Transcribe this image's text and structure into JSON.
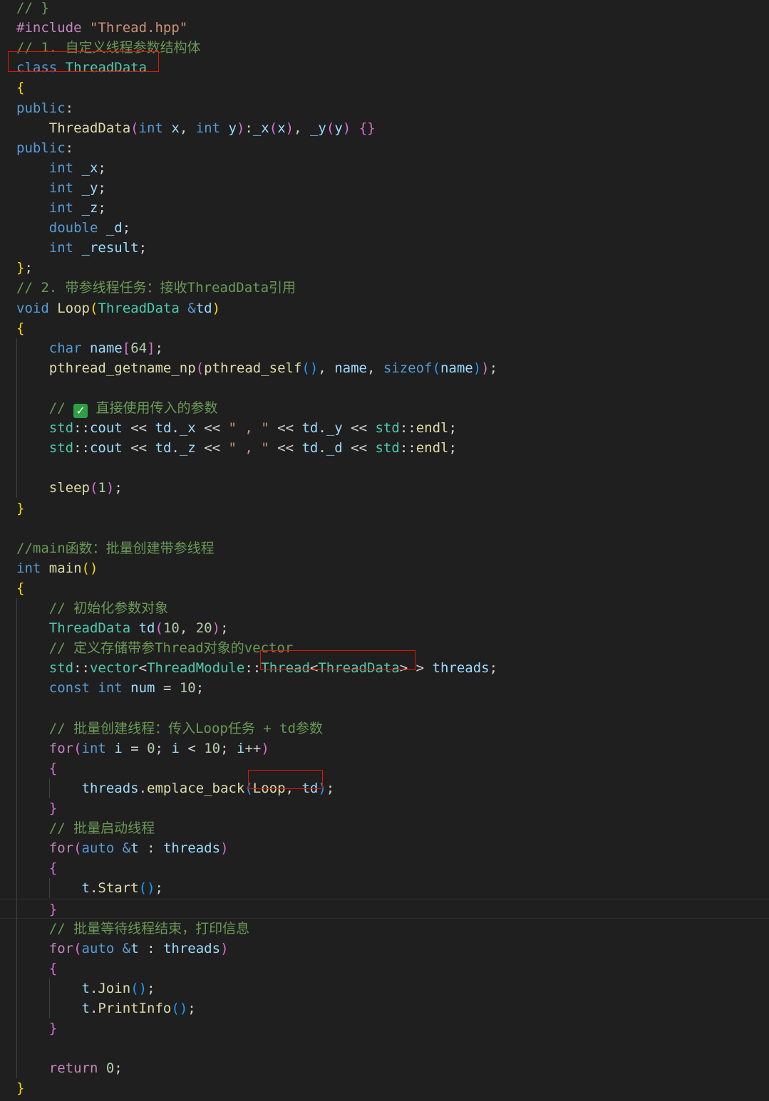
{
  "editor": {
    "language": "cpp",
    "colors": {
      "background": "#1f1f1f",
      "text": "#d4d4d4",
      "keyword": "#569cd6",
      "control": "#c586c0",
      "type": "#4ec9b0",
      "function": "#dcdcaa",
      "variable": "#9cdcfe",
      "string": "#ce9178",
      "number": "#b5cea8",
      "comment": "#6a9955",
      "macro": "#c586c0",
      "bracket_1": "#ffd700",
      "bracket_2": "#da70d6",
      "bracket_3": "#179fff",
      "highlight_box": "#e51400",
      "checkmark": "#2ea043"
    },
    "lines": [
      [
        {
          "t": "// }",
          "c": "#6a9955"
        }
      ],
      [
        {
          "t": "#include ",
          "c": "#c586c0"
        },
        {
          "t": "\"Thread.hpp\"",
          "c": "#ce9178"
        }
      ],
      [
        {
          "t": "// 1. 自定义线程参数结构体",
          "c": "#6a9955"
        }
      ],
      [
        {
          "t": "class ",
          "c": "#569cd6"
        },
        {
          "t": "ThreadData",
          "c": "#4ec9b0"
        }
      ],
      [
        {
          "t": "{",
          "c": "#ffd700"
        }
      ],
      [
        {
          "t": "public",
          "c": "#569cd6"
        },
        {
          "t": ":",
          "c": "#d4d4d4"
        }
      ],
      [
        {
          "t": "    "
        },
        {
          "t": "ThreadData",
          "c": "#dcdcaa"
        },
        {
          "t": "(",
          "c": "#da70d6"
        },
        {
          "t": "int ",
          "c": "#569cd6"
        },
        {
          "t": "x",
          "c": "#9cdcfe"
        },
        {
          "t": ", "
        },
        {
          "t": "int ",
          "c": "#569cd6"
        },
        {
          "t": "y",
          "c": "#9cdcfe"
        },
        {
          "t": ")",
          "c": "#da70d6"
        },
        {
          "t": ":"
        },
        {
          "t": "_x",
          "c": "#9cdcfe"
        },
        {
          "t": "(",
          "c": "#da70d6"
        },
        {
          "t": "x",
          "c": "#9cdcfe"
        },
        {
          "t": ")",
          "c": "#da70d6"
        },
        {
          "t": ", "
        },
        {
          "t": "_y",
          "c": "#9cdcfe"
        },
        {
          "t": "(",
          "c": "#da70d6"
        },
        {
          "t": "y",
          "c": "#9cdcfe"
        },
        {
          "t": ")",
          "c": "#da70d6"
        },
        {
          "t": " "
        },
        {
          "t": "{}",
          "c": "#da70d6"
        }
      ],
      [
        {
          "t": "public",
          "c": "#569cd6"
        },
        {
          "t": ":",
          "c": "#d4d4d4"
        }
      ],
      [
        {
          "t": "    "
        },
        {
          "t": "int ",
          "c": "#569cd6"
        },
        {
          "t": "_x",
          "c": "#9cdcfe"
        },
        {
          "t": ";"
        }
      ],
      [
        {
          "t": "    "
        },
        {
          "t": "int ",
          "c": "#569cd6"
        },
        {
          "t": "_y",
          "c": "#9cdcfe"
        },
        {
          "t": ";"
        }
      ],
      [
        {
          "t": "    "
        },
        {
          "t": "int ",
          "c": "#569cd6"
        },
        {
          "t": "_z",
          "c": "#9cdcfe"
        },
        {
          "t": ";"
        }
      ],
      [
        {
          "t": "    "
        },
        {
          "t": "double ",
          "c": "#569cd6"
        },
        {
          "t": "_d",
          "c": "#9cdcfe"
        },
        {
          "t": ";"
        }
      ],
      [
        {
          "t": "    "
        },
        {
          "t": "int ",
          "c": "#569cd6"
        },
        {
          "t": "_result",
          "c": "#9cdcfe"
        },
        {
          "t": ";"
        }
      ],
      [
        {
          "t": "}",
          "c": "#ffd700"
        },
        {
          "t": ";"
        }
      ],
      [
        {
          "t": "// 2. 带参线程任务：接收ThreadData引用",
          "c": "#6a9955"
        }
      ],
      [
        {
          "t": "void ",
          "c": "#569cd6"
        },
        {
          "t": "Loop",
          "c": "#dcdcaa"
        },
        {
          "t": "(",
          "c": "#ffd700"
        },
        {
          "t": "ThreadData ",
          "c": "#4ec9b0"
        },
        {
          "t": "&",
          "c": "#569cd6"
        },
        {
          "t": "td",
          "c": "#9cdcfe"
        },
        {
          "t": ")",
          "c": "#ffd700"
        }
      ],
      [
        {
          "t": "{",
          "c": "#ffd700"
        }
      ],
      [
        {
          "t": "    "
        },
        {
          "t": "char ",
          "c": "#569cd6"
        },
        {
          "t": "name",
          "c": "#9cdcfe"
        },
        {
          "t": "[",
          "c": "#da70d6"
        },
        {
          "t": "64",
          "c": "#b5cea8"
        },
        {
          "t": "]",
          "c": "#da70d6"
        },
        {
          "t": ";"
        }
      ],
      [
        {
          "t": "    "
        },
        {
          "t": "pthread_getname_np",
          "c": "#dcdcaa"
        },
        {
          "t": "(",
          "c": "#da70d6"
        },
        {
          "t": "pthread_self",
          "c": "#dcdcaa"
        },
        {
          "t": "()",
          "c": "#179fff"
        },
        {
          "t": ", "
        },
        {
          "t": "name",
          "c": "#9cdcfe"
        },
        {
          "t": ", "
        },
        {
          "t": "sizeof",
          "c": "#569cd6"
        },
        {
          "t": "(",
          "c": "#179fff"
        },
        {
          "t": "name",
          "c": "#9cdcfe"
        },
        {
          "t": ")",
          "c": "#179fff"
        },
        {
          "t": ")",
          "c": "#da70d6"
        },
        {
          "t": ";"
        }
      ],
      [],
      [
        {
          "t": "    "
        },
        {
          "t": "// ",
          "c": "#6a9955"
        },
        {
          "icon": "checkmark"
        },
        {
          "t": " 直接使用传入的参数",
          "c": "#6a9955"
        }
      ],
      [
        {
          "t": "    "
        },
        {
          "t": "std",
          "c": "#4ec9b0"
        },
        {
          "t": "::"
        },
        {
          "t": "cout",
          "c": "#9cdcfe"
        },
        {
          "t": " << "
        },
        {
          "t": "td",
          "c": "#9cdcfe"
        },
        {
          "t": "."
        },
        {
          "t": "_x",
          "c": "#9cdcfe"
        },
        {
          "t": " << "
        },
        {
          "t": "\" , \"",
          "c": "#ce9178"
        },
        {
          "t": " << "
        },
        {
          "t": "td",
          "c": "#9cdcfe"
        },
        {
          "t": "."
        },
        {
          "t": "_y",
          "c": "#9cdcfe"
        },
        {
          "t": " << "
        },
        {
          "t": "std",
          "c": "#4ec9b0"
        },
        {
          "t": "::"
        },
        {
          "t": "endl",
          "c": "#dcdcaa"
        },
        {
          "t": ";"
        }
      ],
      [
        {
          "t": "    "
        },
        {
          "t": "std",
          "c": "#4ec9b0"
        },
        {
          "t": "::"
        },
        {
          "t": "cout",
          "c": "#9cdcfe"
        },
        {
          "t": " << "
        },
        {
          "t": "td",
          "c": "#9cdcfe"
        },
        {
          "t": "."
        },
        {
          "t": "_z",
          "c": "#9cdcfe"
        },
        {
          "t": " << "
        },
        {
          "t": "\" , \"",
          "c": "#ce9178"
        },
        {
          "t": " << "
        },
        {
          "t": "td",
          "c": "#9cdcfe"
        },
        {
          "t": "."
        },
        {
          "t": "_d",
          "c": "#9cdcfe"
        },
        {
          "t": " << "
        },
        {
          "t": "std",
          "c": "#4ec9b0"
        },
        {
          "t": "::"
        },
        {
          "t": "endl",
          "c": "#dcdcaa"
        },
        {
          "t": ";"
        }
      ],
      [],
      [
        {
          "t": "    "
        },
        {
          "t": "sleep",
          "c": "#dcdcaa"
        },
        {
          "t": "(",
          "c": "#da70d6"
        },
        {
          "t": "1",
          "c": "#b5cea8"
        },
        {
          "t": ")",
          "c": "#da70d6"
        },
        {
          "t": ";"
        }
      ],
      [
        {
          "t": "}",
          "c": "#ffd700"
        }
      ],
      [],
      [
        {
          "t": "//main函数：批量创建带参线程",
          "c": "#6a9955"
        }
      ],
      [
        {
          "t": "int ",
          "c": "#569cd6"
        },
        {
          "t": "main",
          "c": "#dcdcaa"
        },
        {
          "t": "()",
          "c": "#ffd700"
        }
      ],
      [
        {
          "t": "{",
          "c": "#ffd700"
        }
      ],
      [
        {
          "t": "    "
        },
        {
          "t": "// 初始化参数对象",
          "c": "#6a9955"
        }
      ],
      [
        {
          "t": "    "
        },
        {
          "t": "ThreadData ",
          "c": "#4ec9b0"
        },
        {
          "t": "td",
          "c": "#9cdcfe"
        },
        {
          "t": "(",
          "c": "#da70d6"
        },
        {
          "t": "10",
          "c": "#b5cea8"
        },
        {
          "t": ", "
        },
        {
          "t": "20",
          "c": "#b5cea8"
        },
        {
          "t": ")",
          "c": "#da70d6"
        },
        {
          "t": ";"
        }
      ],
      [
        {
          "t": "    "
        },
        {
          "t": "// 定义存储带参Thread对象的vector",
          "c": "#6a9955"
        }
      ],
      [
        {
          "t": "    "
        },
        {
          "t": "std",
          "c": "#4ec9b0"
        },
        {
          "t": "::"
        },
        {
          "t": "vector",
          "c": "#4ec9b0"
        },
        {
          "t": "<"
        },
        {
          "t": "ThreadModule",
          "c": "#4ec9b0"
        },
        {
          "t": "::"
        },
        {
          "t": "Thread",
          "c": "#4ec9b0"
        },
        {
          "t": "<"
        },
        {
          "t": "ThreadData",
          "c": "#4ec9b0"
        },
        {
          "t": ">"
        },
        {
          "t": " > "
        },
        {
          "t": "threads",
          "c": "#9cdcfe"
        },
        {
          "t": ";"
        }
      ],
      [
        {
          "t": "    "
        },
        {
          "t": "const ",
          "c": "#569cd6"
        },
        {
          "t": "int ",
          "c": "#569cd6"
        },
        {
          "t": "num",
          "c": "#9cdcfe"
        },
        {
          "t": " = "
        },
        {
          "t": "10",
          "c": "#b5cea8"
        },
        {
          "t": ";"
        }
      ],
      [],
      [
        {
          "t": "    "
        },
        {
          "t": "// 批量创建线程：传入Loop任务 + td参数",
          "c": "#6a9955"
        }
      ],
      [
        {
          "t": "    "
        },
        {
          "t": "for",
          "c": "#c586c0"
        },
        {
          "t": "(",
          "c": "#da70d6"
        },
        {
          "t": "int ",
          "c": "#569cd6"
        },
        {
          "t": "i",
          "c": "#9cdcfe"
        },
        {
          "t": " = "
        },
        {
          "t": "0",
          "c": "#b5cea8"
        },
        {
          "t": "; "
        },
        {
          "t": "i",
          "c": "#9cdcfe"
        },
        {
          "t": " < "
        },
        {
          "t": "10",
          "c": "#b5cea8"
        },
        {
          "t": "; "
        },
        {
          "t": "i",
          "c": "#9cdcfe"
        },
        {
          "t": "++"
        },
        {
          "t": ")",
          "c": "#da70d6"
        }
      ],
      [
        {
          "t": "    "
        },
        {
          "t": "{",
          "c": "#da70d6"
        }
      ],
      [
        {
          "t": "        "
        },
        {
          "t": "threads",
          "c": "#9cdcfe"
        },
        {
          "t": "."
        },
        {
          "t": "emplace_back",
          "c": "#dcdcaa"
        },
        {
          "t": "(",
          "c": "#179fff"
        },
        {
          "t": "Loop",
          "c": "#dcdcaa"
        },
        {
          "t": ", "
        },
        {
          "t": "td",
          "c": "#9cdcfe"
        },
        {
          "t": ")",
          "c": "#179fff"
        },
        {
          "t": ";"
        }
      ],
      [
        {
          "t": "    "
        },
        {
          "t": "}",
          "c": "#da70d6"
        }
      ],
      [
        {
          "t": "    "
        },
        {
          "t": "// 批量启动线程",
          "c": "#6a9955"
        }
      ],
      [
        {
          "t": "    "
        },
        {
          "t": "for",
          "c": "#c586c0"
        },
        {
          "t": "(",
          "c": "#da70d6"
        },
        {
          "t": "auto ",
          "c": "#569cd6"
        },
        {
          "t": "&",
          "c": "#569cd6"
        },
        {
          "t": "t",
          "c": "#9cdcfe"
        },
        {
          "t": " : "
        },
        {
          "t": "threads",
          "c": "#9cdcfe"
        },
        {
          "t": ")",
          "c": "#da70d6"
        }
      ],
      [
        {
          "t": "    "
        },
        {
          "t": "{",
          "c": "#da70d6"
        }
      ],
      [
        {
          "t": "        "
        },
        {
          "t": "t",
          "c": "#9cdcfe"
        },
        {
          "t": "."
        },
        {
          "t": "Start",
          "c": "#dcdcaa"
        },
        {
          "t": "()",
          "c": "#179fff"
        },
        {
          "t": ";"
        }
      ],
      [
        {
          "t": "    "
        },
        {
          "t": "}",
          "c": "#da70d6"
        }
      ],
      [
        {
          "t": "    "
        },
        {
          "t": "// 批量等待线程结束，打印信息",
          "c": "#6a9955"
        }
      ],
      [
        {
          "t": "    "
        },
        {
          "t": "for",
          "c": "#c586c0"
        },
        {
          "t": "(",
          "c": "#da70d6"
        },
        {
          "t": "auto ",
          "c": "#569cd6"
        },
        {
          "t": "&",
          "c": "#569cd6"
        },
        {
          "t": "t",
          "c": "#9cdcfe"
        },
        {
          "t": " : "
        },
        {
          "t": "threads",
          "c": "#9cdcfe"
        },
        {
          "t": ")",
          "c": "#da70d6"
        }
      ],
      [
        {
          "t": "    "
        },
        {
          "t": "{",
          "c": "#da70d6"
        }
      ],
      [
        {
          "t": "        "
        },
        {
          "t": "t",
          "c": "#9cdcfe"
        },
        {
          "t": "."
        },
        {
          "t": "Join",
          "c": "#dcdcaa"
        },
        {
          "t": "()",
          "c": "#179fff"
        },
        {
          "t": ";"
        }
      ],
      [
        {
          "t": "        "
        },
        {
          "t": "t",
          "c": "#9cdcfe"
        },
        {
          "t": "."
        },
        {
          "t": "PrintInfo",
          "c": "#dcdcaa"
        },
        {
          "t": "()",
          "c": "#179fff"
        },
        {
          "t": ";"
        }
      ],
      [
        {
          "t": "    "
        },
        {
          "t": "}",
          "c": "#da70d6"
        }
      ],
      [],
      [
        {
          "t": "    "
        },
        {
          "t": "return ",
          "c": "#c586c0"
        },
        {
          "t": "0",
          "c": "#b5cea8"
        },
        {
          "t": ";"
        }
      ],
      [
        {
          "t": "}",
          "c": "#ffd700"
        }
      ]
    ]
  }
}
